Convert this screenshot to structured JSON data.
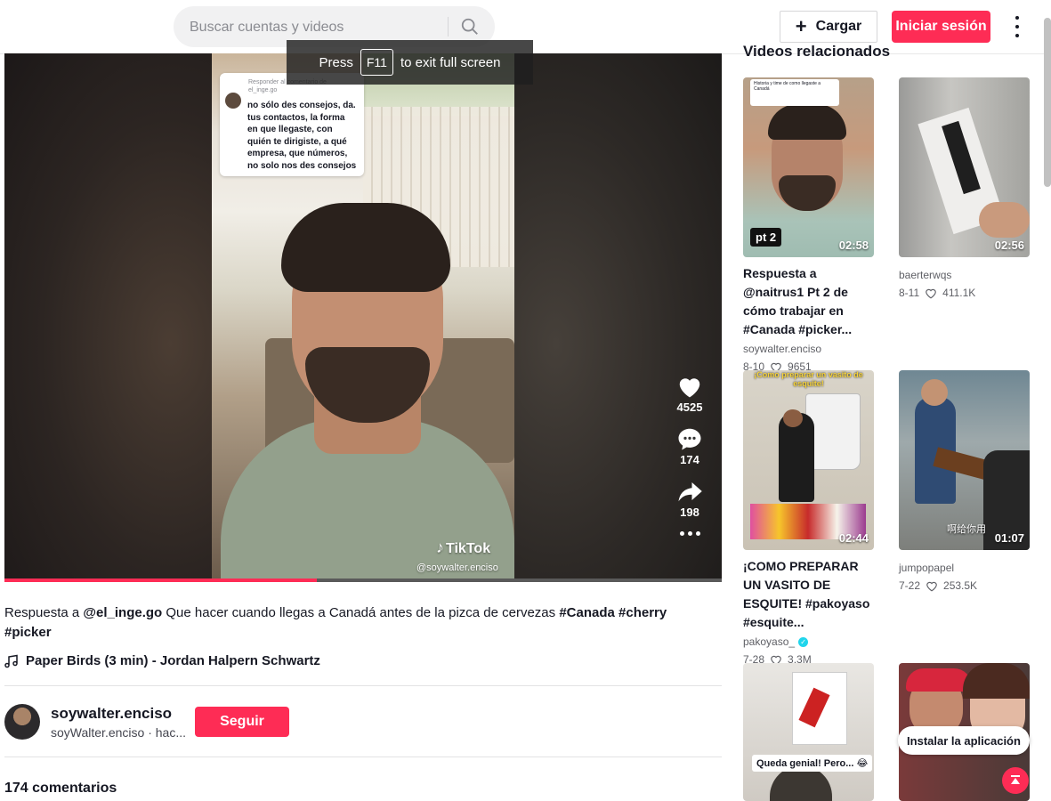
{
  "search": {
    "placeholder": "Buscar cuentas y videos"
  },
  "header": {
    "upload_label": "Cargar",
    "login_label": "Iniciar sesión"
  },
  "fullscreen_hint": {
    "press": "Press",
    "key": "F11",
    "rest": "to exit full screen"
  },
  "video": {
    "reply_header": "Responder al comentario de el_inge.go",
    "reply_text": "no sólo des consejos, da. tus contactos, la forma en que llegaste, con quién te dirigiste, a qué empresa, que números, no solo nos des consejos",
    "watermark": "TikTok",
    "handle": "@soywalter.enciso",
    "likes": "4525",
    "comments": "174",
    "shares": "198",
    "progress": 0.435
  },
  "description": {
    "prefix": "Respuesta a ",
    "mention": "@el_inge.go",
    "text": " Que hacer cuando llegas a Canadá antes de la pizca de cervezas ",
    "tags": [
      "#Canada",
      "#cherry",
      "#picker"
    ]
  },
  "music": "Paper Birds (3 min) - Jordan Halpern Schwartz",
  "author": {
    "name": "soywalter.enciso",
    "sub": "soyWalter.enciso · hac...",
    "follow_label": "Seguir"
  },
  "comments_count": "174 comentarios",
  "related": {
    "title": "Videos relacionados",
    "items": [
      {
        "title": "Respuesta a @naitrus1 Pt 2 de cómo trabajar en #Canada #picker...",
        "author": "soywalter.enciso",
        "date": "8-10",
        "likes": "9651",
        "duration": "02:58",
        "badge": "pt 2",
        "overlay": "Historia y time de como llegaste a Canadá"
      },
      {
        "title": "",
        "author": "baerterwqs",
        "date": "8-11",
        "likes": "411.1K",
        "duration": "02:56"
      },
      {
        "title": "¡COMO PREPARAR UN VASITO DE ESQUITE! #pakoyaso #esquite...",
        "author": "pakoyaso_",
        "date": "7-28",
        "likes": "3.3M",
        "duration": "02:44",
        "overlay": "¡Como preparar un vasito de esquite!"
      },
      {
        "title": "",
        "author": "jumpopapel",
        "date": "7-22",
        "likes": "253.5K",
        "duration": "01:07",
        "overlay": "啊给你用"
      },
      {
        "caption": "Queda genial! Pero... 😂"
      },
      {
        "caption": ""
      }
    ]
  },
  "install_label": "Instalar la aplicación"
}
